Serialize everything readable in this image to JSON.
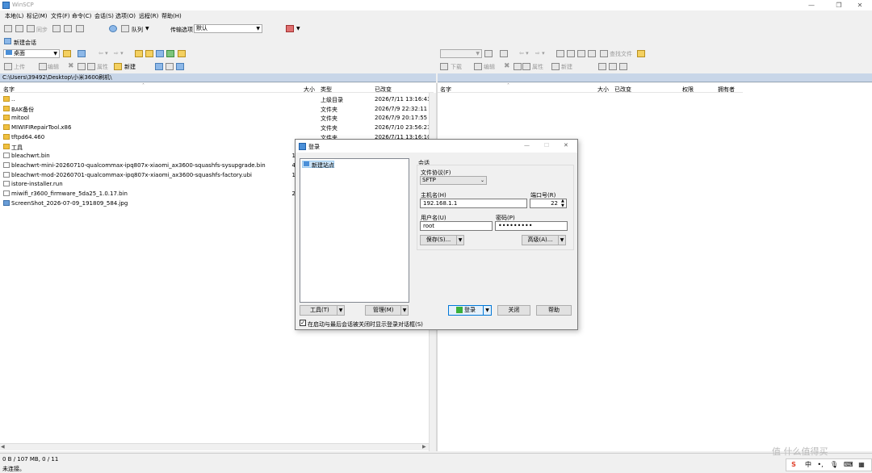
{
  "window": {
    "title": "WinSCP"
  },
  "menu": [
    "本地(L)",
    "标记(M)",
    "文件(F)",
    "命令(C)",
    "会话(S)",
    "选项(O)",
    "远程(R)",
    "帮助(H)"
  ],
  "toolbar1": {
    "sync": "同步",
    "queue": "队列",
    "transfer_label": "传输选项",
    "transfer_value": "默认"
  },
  "session_tab": "新建会话",
  "local": {
    "drive": "桌面",
    "upload": "上传",
    "edit": "编辑",
    "props": "属性",
    "new": "新建",
    "path": "C:\\Users\\39492\\Desktop\\小米3600刷机\\",
    "columns": {
      "name": "名字",
      "size": "大小",
      "type": "类型",
      "modified": "已改变"
    },
    "rows": [
      {
        "name": "..",
        "size": "",
        "type": "上级目录",
        "modified": "2026/7/11  13:16:43",
        "kind": "up"
      },
      {
        "name": "BAK备份",
        "size": "",
        "type": "文件夹",
        "modified": "2026/7/9  22:32:11",
        "kind": "folder"
      },
      {
        "name": "mitool",
        "size": "",
        "type": "文件夹",
        "modified": "2026/7/9  20:17:55",
        "kind": "folder"
      },
      {
        "name": "MIWIFIRepairTool.x86",
        "size": "",
        "type": "文件夹",
        "modified": "2026/7/10  23:56:23",
        "kind": "folder"
      },
      {
        "name": "tftpd64.460",
        "size": "",
        "type": "文件夹",
        "modified": "2026/7/11  13:16:10",
        "kind": "folder"
      },
      {
        "name": "工具",
        "size": "",
        "type": "",
        "modified": "",
        "kind": "folder"
      },
      {
        "name": "bleachwrt.bin",
        "size": "1",
        "type": "",
        "modified": "",
        "kind": "file"
      },
      {
        "name": "bleachwrt-mini-20260710-qualcommax-ipq807x-xiaomi_ax3600-squashfs-sysupgrade.bin",
        "size": "4",
        "type": "",
        "modified": "",
        "kind": "file"
      },
      {
        "name": "bleachwrt-mod-20260701-qualcommax-ipq807x-xiaomi_ax3600-squashfs-factory.ubi",
        "size": "1",
        "type": "",
        "modified": "",
        "kind": "file"
      },
      {
        "name": "istore-installer.run",
        "size": "",
        "type": "",
        "modified": "",
        "kind": "file"
      },
      {
        "name": "miwifi_r3600_firmware_5da25_1.0.17.bin",
        "size": "2",
        "type": "",
        "modified": "",
        "kind": "file"
      },
      {
        "name": "ScreenShot_2026-07-09_191809_584.jpg",
        "size": "",
        "type": "",
        "modified": "",
        "kind": "img"
      }
    ]
  },
  "remote": {
    "download": "下载",
    "edit": "编辑",
    "props": "属性",
    "new": "新建",
    "find": "查找文件",
    "columns": {
      "name": "名字",
      "size": "大小",
      "modified": "已改变",
      "rights": "权限",
      "owner": "拥有者"
    }
  },
  "status": {
    "summary": "0 B / 107 MB,  0 / 11",
    "connection": "未连接。"
  },
  "login_dialog": {
    "title": "登录",
    "site_item": "新建站点",
    "session_heading": "会话",
    "protocol_label": "文件协议(F)",
    "protocol_value": "SFTP",
    "host_label": "主机名(H)",
    "host_value": "192.168.1.1",
    "port_label": "端口号(R)",
    "port_value": "22",
    "user_label": "用户名(U)",
    "user_value": "root",
    "pass_label": "密码(P)",
    "pass_value": "•••••••••",
    "save_btn": "保存(S)...",
    "advanced_btn": "高级(A)...",
    "tools_btn": "工具(T)",
    "manage_btn": "管理(M)",
    "login_btn": "登录",
    "close_btn": "关闭",
    "help_btn": "帮助",
    "checkbox_label": "在启动与最后会话被关闭时显示登录对话框(S)"
  },
  "ime": {
    "lang": "中",
    "punct": "•,"
  },
  "watermark": "值 什么值得买"
}
